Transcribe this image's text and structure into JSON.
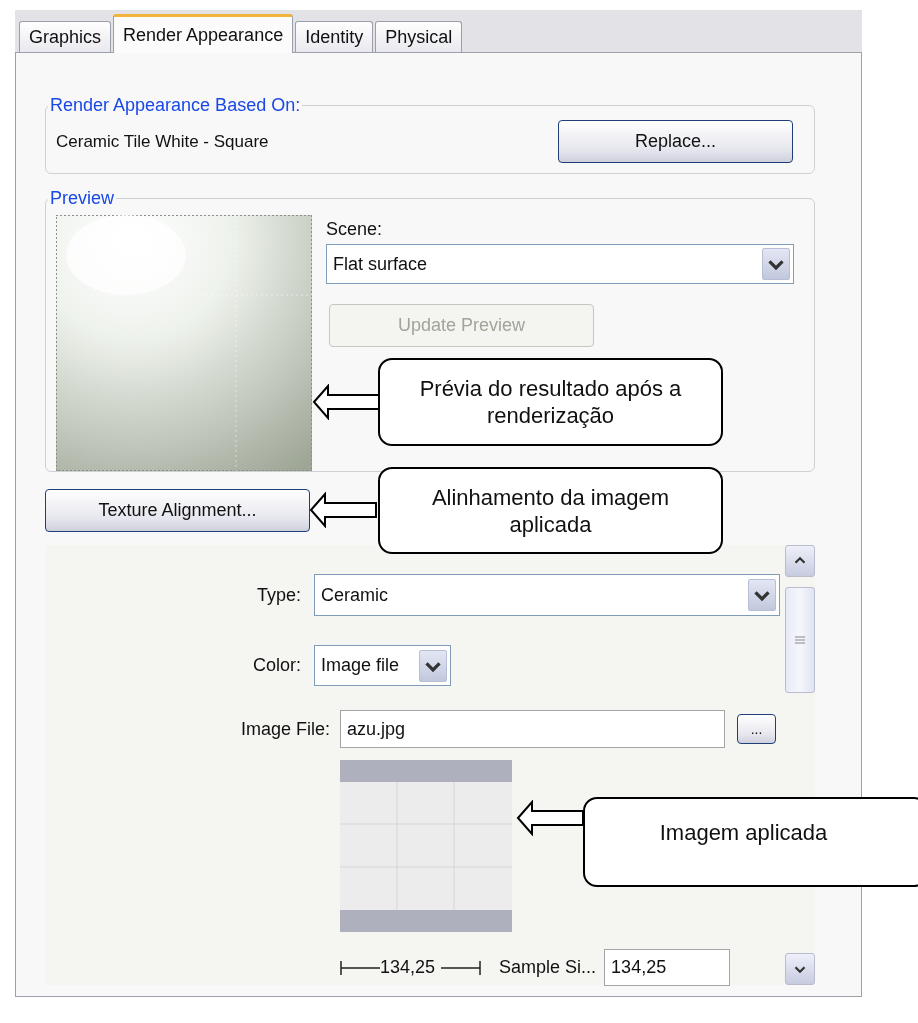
{
  "tabs": [
    {
      "label": "Graphics",
      "selected": false
    },
    {
      "label": "Render Appearance",
      "selected": true
    },
    {
      "label": "Identity",
      "selected": false
    },
    {
      "label": "Physical",
      "selected": false
    }
  ],
  "based_on": {
    "legend": "Render Appearance Based On:",
    "material": "Ceramic Tile White - Square",
    "button": "Replace..."
  },
  "preview": {
    "legend": "Preview",
    "scene_label": "Scene:",
    "scene_value": "Flat surface",
    "update_button": {
      "label": "Update Preview",
      "disabled": true
    }
  },
  "texture_alignment_button": "Texture Alignment...",
  "properties": {
    "type": {
      "label": "Type:",
      "value": "Ceramic"
    },
    "color": {
      "label": "Color:",
      "value": "Image file"
    },
    "image_file": {
      "label": "Image File:",
      "value": "azu.jpg",
      "browse_button": "..."
    },
    "width_reading": "134,25",
    "sample_size": {
      "label": "Sample Si...",
      "value": "134,25"
    }
  },
  "callouts": [
    {
      "text": "Prévia do resultado após a renderização"
    },
    {
      "text": "Alinhamento da imagem aplicada"
    },
    {
      "text": "Imagem aplicada"
    }
  ]
}
